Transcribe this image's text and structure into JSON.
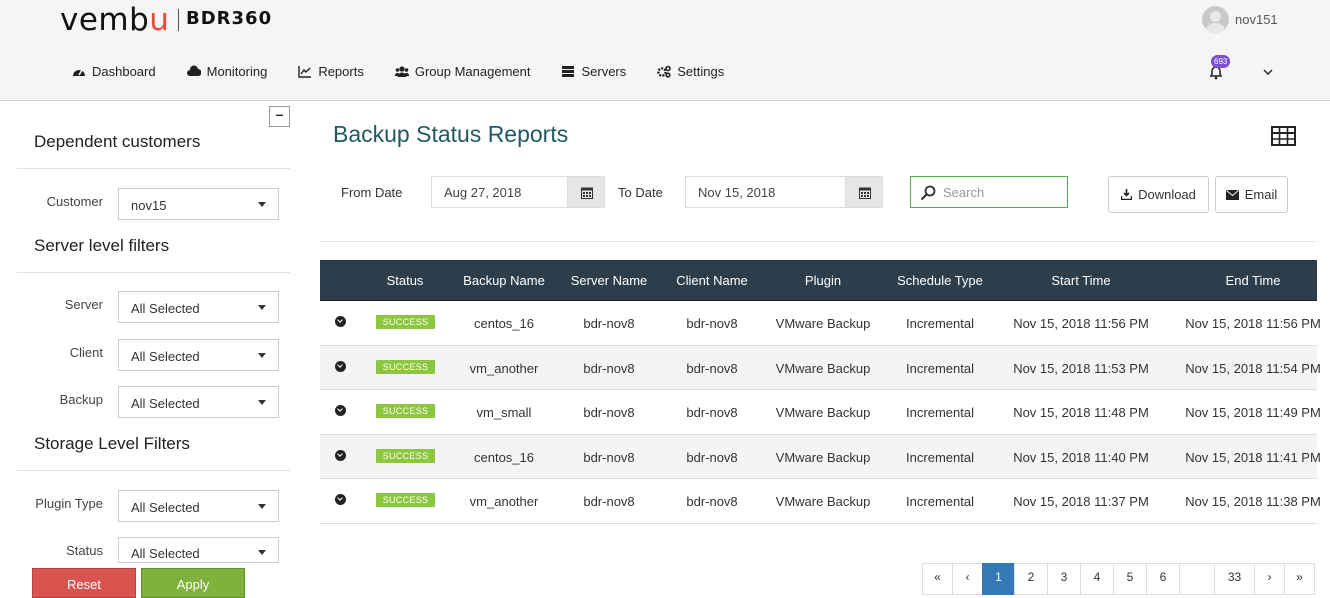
{
  "brand": {
    "logo_a": "vemb",
    "logo_b": "u",
    "product": "BDR360"
  },
  "user": {
    "name": "nov151"
  },
  "notifications": {
    "count": "693"
  },
  "nav": [
    {
      "label": "Dashboard",
      "icon": "dashboard-icon"
    },
    {
      "label": "Monitoring",
      "icon": "cloud-icon"
    },
    {
      "label": "Reports",
      "icon": "line-chart-icon"
    },
    {
      "label": "Group Management",
      "icon": "users-icon"
    },
    {
      "label": "Servers",
      "icon": "server-icon"
    },
    {
      "label": "Settings",
      "icon": "gears-icon"
    }
  ],
  "sidebar": {
    "collapse_label": "−",
    "dependent_title": "Dependent customers",
    "customer_label": "Customer",
    "customer_value": "nov15",
    "server_title": "Server level filters",
    "server_label": "Server",
    "server_value": "All Selected",
    "client_label": "Client",
    "client_value": "All Selected",
    "backup_label": "Backup",
    "backup_value": "All Selected",
    "storage_title": "Storage Level Filters",
    "plugin_label": "Plugin Type",
    "plugin_value": "All Selected",
    "status_label": "Status",
    "status_value": "All Selected",
    "reset_label": "Reset",
    "apply_label": "Apply"
  },
  "main": {
    "title": "Backup Status Reports",
    "from_label": "From Date",
    "from_value": "Aug 27, 2018",
    "to_label": "To Date",
    "to_value": "Nov 15, 2018",
    "search_placeholder": "Search",
    "download_label": "Download",
    "email_label": "Email"
  },
  "table": {
    "headers": [
      "Status",
      "Backup Name",
      "Server Name",
      "Client Name",
      "Plugin",
      "Schedule Type",
      "Start Time",
      "End Time"
    ],
    "rows": [
      {
        "status": "SUCCESS",
        "backup": "centos_16",
        "server": "bdr-nov8",
        "client": "bdr-nov8",
        "plugin": "VMware Backup",
        "schedule": "Incremental",
        "start": "Nov 15, 2018 11:56 PM",
        "end": "Nov 15, 2018 11:56 PM"
      },
      {
        "status": "SUCCESS",
        "backup": "vm_another",
        "server": "bdr-nov8",
        "client": "bdr-nov8",
        "plugin": "VMware Backup",
        "schedule": "Incremental",
        "start": "Nov 15, 2018 11:53 PM",
        "end": "Nov 15, 2018 11:54 PM"
      },
      {
        "status": "SUCCESS",
        "backup": "vm_small",
        "server": "bdr-nov8",
        "client": "bdr-nov8",
        "plugin": "VMware Backup",
        "schedule": "Incremental",
        "start": "Nov 15, 2018 11:48 PM",
        "end": "Nov 15, 2018 11:49 PM"
      },
      {
        "status": "SUCCESS",
        "backup": "centos_16",
        "server": "bdr-nov8",
        "client": "bdr-nov8",
        "plugin": "VMware Backup",
        "schedule": "Incremental",
        "start": "Nov 15, 2018 11:40 PM",
        "end": "Nov 15, 2018 11:41 PM"
      },
      {
        "status": "SUCCESS",
        "backup": "vm_another",
        "server": "bdr-nov8",
        "client": "bdr-nov8",
        "plugin": "VMware Backup",
        "schedule": "Incremental",
        "start": "Nov 15, 2018 11:37 PM",
        "end": "Nov 15, 2018 11:38 PM"
      }
    ]
  },
  "pagination": {
    "first": "«",
    "prev": "‹",
    "pages": [
      "1",
      "2",
      "3",
      "4",
      "5",
      "6",
      "",
      "33"
    ],
    "active": "1",
    "next": "›",
    "last": "»"
  },
  "colors": {
    "title": "#1f5a63",
    "header_bg": "#2c3e4c",
    "success": "#8dc63f",
    "reset": "#d9534f",
    "apply": "#7fb13d",
    "active_page": "#337ab7",
    "badge": "#7b4fd6"
  }
}
